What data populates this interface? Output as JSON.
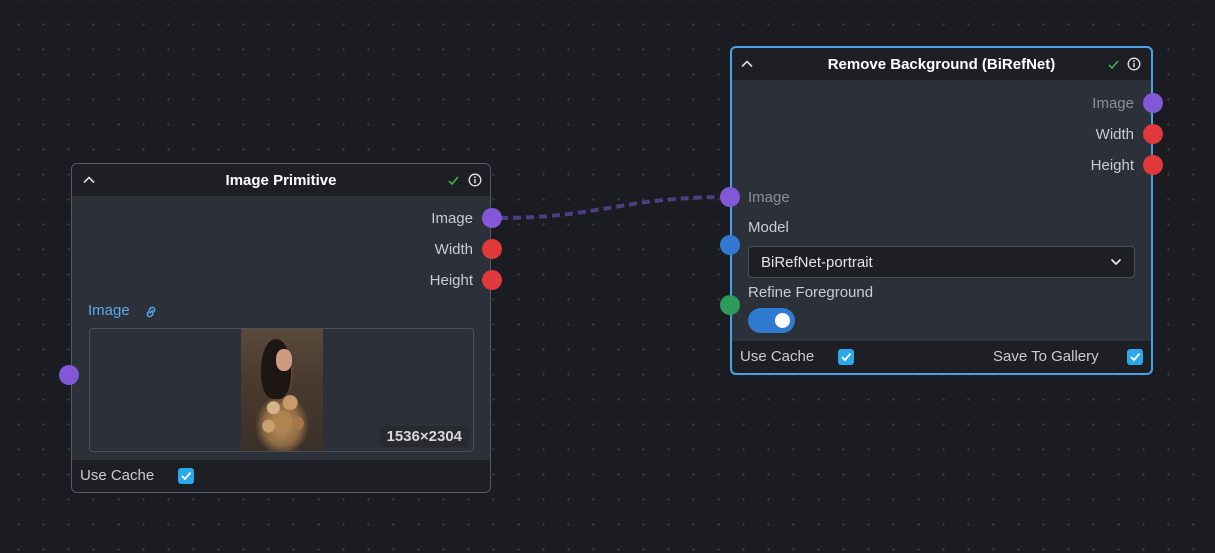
{
  "colors": {
    "canvas": "#1b1c21",
    "node_body": "#2c3038",
    "node_header": "#1d1f25",
    "selected_border": "#4aa3e8",
    "port_image": "#8257d8",
    "port_number": "#e0383b",
    "port_enum": "#2f7ad0",
    "port_bool": "#2c9a5b",
    "wire": "#4c3d84",
    "checkbox": "#2ba8ea"
  },
  "image_primitive": {
    "title": "Image Primitive",
    "status_icon": "check-icon",
    "info_icon": "info-icon",
    "outputs": [
      "Image",
      "Width",
      "Height"
    ],
    "image_field": {
      "label": "Image",
      "icon": "link-icon",
      "dimensions": "1536×2304"
    },
    "footer": {
      "use_cache_label": "Use Cache",
      "use_cache_checked": true
    }
  },
  "remove_background": {
    "title": "Remove Background (BiRefNet)",
    "status_icon": "check-icon",
    "info_icon": "info-icon",
    "outputs": [
      "Image",
      "Width",
      "Height"
    ],
    "inputs": {
      "image_label": "Image",
      "model_label": "Model",
      "model_value": "BiRefNet-portrait",
      "refine_label": "Refine Foreground",
      "refine_enabled": true
    },
    "footer": {
      "use_cache_label": "Use Cache",
      "use_cache_checked": true,
      "save_to_gallery_label": "Save To Gallery",
      "save_to_gallery_checked": true
    }
  },
  "connections": [
    {
      "from": "Image Primitive.Image",
      "to": "Remove Background (BiRefNet).Image"
    }
  ]
}
